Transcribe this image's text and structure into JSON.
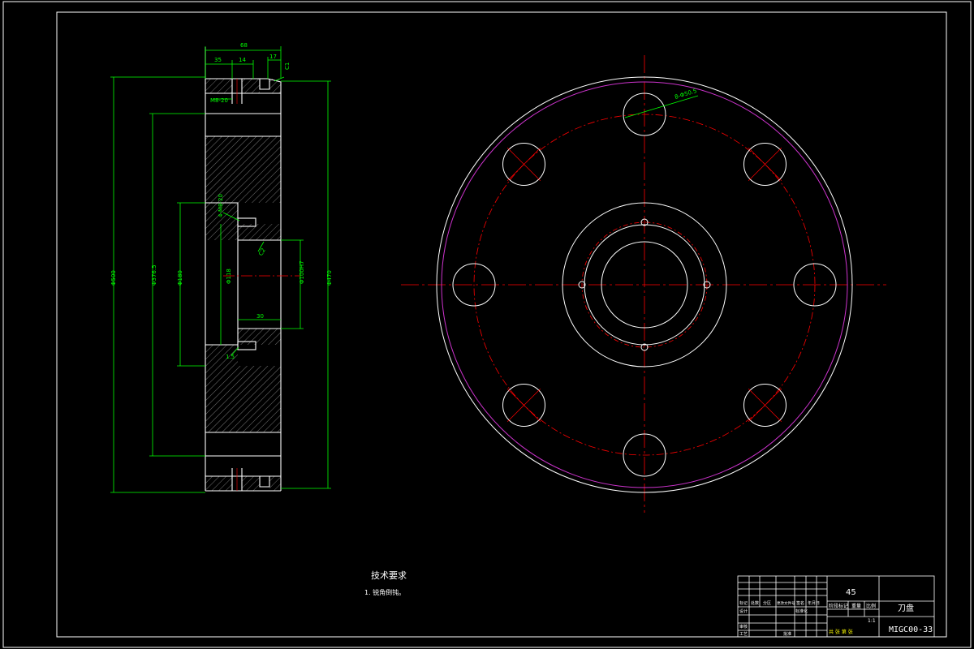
{
  "colors": {
    "background": "#000000",
    "outline": "#ffffff",
    "dimension": "#00ff00",
    "centerline": "#ff0000",
    "outer_ring": "#cc33cc",
    "highlight_text": "#ffff00"
  },
  "technical_requirements": {
    "heading": "技术要求",
    "item_1": "1. 锐角倒钝。"
  },
  "title_block": {
    "material": "45",
    "part_name": "刀盘",
    "drawing_number": "MIGC00-33",
    "stage_label": "阶段标记",
    "weight_label": "重量",
    "scale_label": "比例",
    "scale_value": "1:1",
    "row_labels": [
      "标记",
      "处数",
      "分区",
      "更改文件号",
      "签名",
      "年月日"
    ],
    "left_labels": [
      "设计",
      "审核",
      "工艺"
    ],
    "std_label": "标准化",
    "approve_label": "批准",
    "sheet_text": "共 张 第 张"
  },
  "dimensions": {
    "top_total": "68",
    "top_left": "35",
    "top_mid": "14",
    "top_right": "17",
    "top_corner": "C1",
    "depth_label": "M8-20",
    "outer_dia": "Φ500",
    "outer_dia_right": "Φ470",
    "bolt_circle": "Φ376.5",
    "hub_outer": "Φ180",
    "hub_inner": "Φ118",
    "bore": "Φ100H7",
    "hub_depth": "30",
    "thread_label": "4-M8-20",
    "chamfer_a": "C2",
    "chamfer_b": "1.5",
    "hole_label": "8-Φ50.5"
  }
}
